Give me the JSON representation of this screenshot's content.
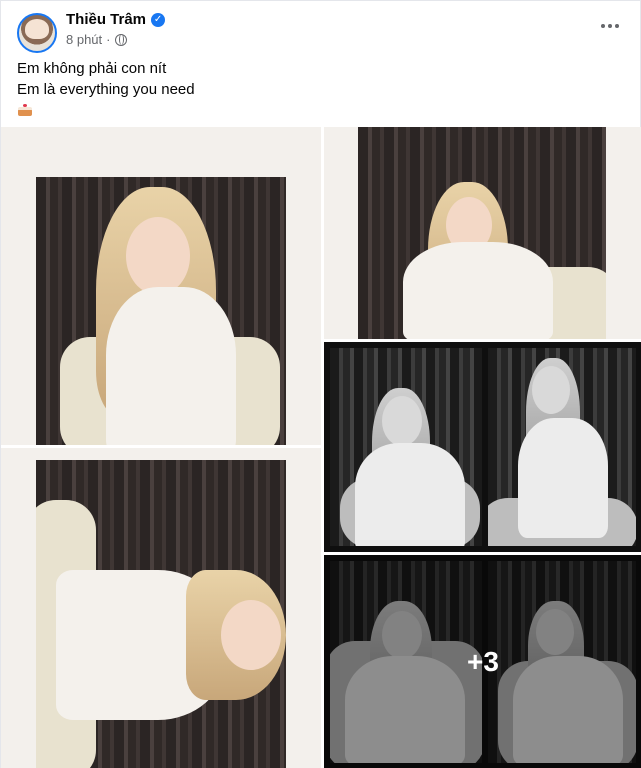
{
  "post": {
    "author": "Thiều Trâm",
    "verified_icon": "verified-check-icon",
    "time": "8 phút",
    "separator": "·",
    "privacy_icon": "globe-icon",
    "menu_icon": "more-options-icon",
    "caption_lines": [
      "Em không phải con nít",
      "Em là everything you need"
    ],
    "caption_emoji": "cake-emoji"
  },
  "gallery": {
    "photo_count_shown": 5,
    "remaining_label": "+3",
    "colors": {
      "polaroid_border": "#f3f0ec",
      "film_black": "#0f0f0f",
      "accent": "#1877f2"
    }
  }
}
